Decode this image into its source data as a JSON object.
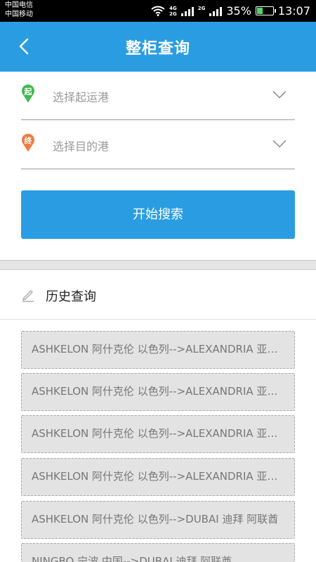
{
  "status_bar": {
    "carrier_1": "中国电信",
    "carrier_2": "中国移动",
    "net_1": "4G",
    "net_2": "2G",
    "net_3": "2G",
    "battery": "35%",
    "battery_level": 0.35,
    "time": "13:07"
  },
  "header": {
    "title": "整柜查询"
  },
  "origin": {
    "badge": "起",
    "placeholder": "选择起运港",
    "badge_color": "#3fb950"
  },
  "destination": {
    "badge": "终",
    "placeholder": "选择目的港",
    "badge_color": "#f07b3f"
  },
  "search_button": {
    "label": "开始搜索"
  },
  "history": {
    "title": "历史查询",
    "items": [
      "ASHKELON 阿什克伦 以色列-->ALEXANDRIA 亚历山大 埃及",
      "ASHKELON 阿什克伦 以色列-->ALEXANDRIA 亚历山大 埃及",
      "ASHKELON 阿什克伦 以色列-->ALEXANDRIA 亚历山大 埃及",
      "ASHKELON 阿什克伦 以色列-->ALEXANDRIA 亚历山大 埃及",
      "ASHKELON 阿什克伦 以色列-->DUBAI 迪拜 阿联酋",
      "NINGBO 宁波 中国-->DUBAI 迪拜 阿联酋"
    ]
  },
  "colors": {
    "primary": "#2a9de2"
  }
}
